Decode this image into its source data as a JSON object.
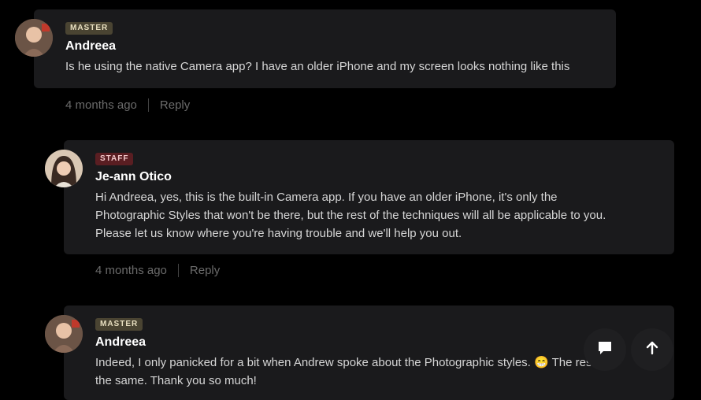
{
  "comments": [
    {
      "badge": "MASTER",
      "author": "Andreea",
      "lines": [
        "Is he using the native Camera app? I have an older iPhone and my screen looks nothing like this"
      ],
      "time": "4 months ago",
      "reply": "Reply"
    },
    {
      "badge": "STAFF",
      "author": "Je-ann Otico",
      "lines": [
        "Hi Andreea, yes, this is the built-in Camera app. If you have an older iPhone, it's only the",
        "Photographic Styles that won't be there, but the rest of the techniques will all be applicable to you.",
        "Please let us know where you're having trouble and we'll help you out."
      ],
      "time": "4 months ago",
      "reply": "Reply"
    },
    {
      "badge": "MASTER",
      "author": "Andreea",
      "lines": [
        "Indeed, I only panicked for a bit when Andrew spoke about the Photographic styles. 😁 The rest is",
        "the same. Thank you so much!"
      ]
    }
  ],
  "icons": {
    "chat": "chat-bubble-icon",
    "up": "arrow-up-icon"
  },
  "colors": {
    "background": "#000000",
    "card": "#1a1a1c",
    "master_badge": "#4a4432",
    "staff_badge": "#5a1e22"
  }
}
